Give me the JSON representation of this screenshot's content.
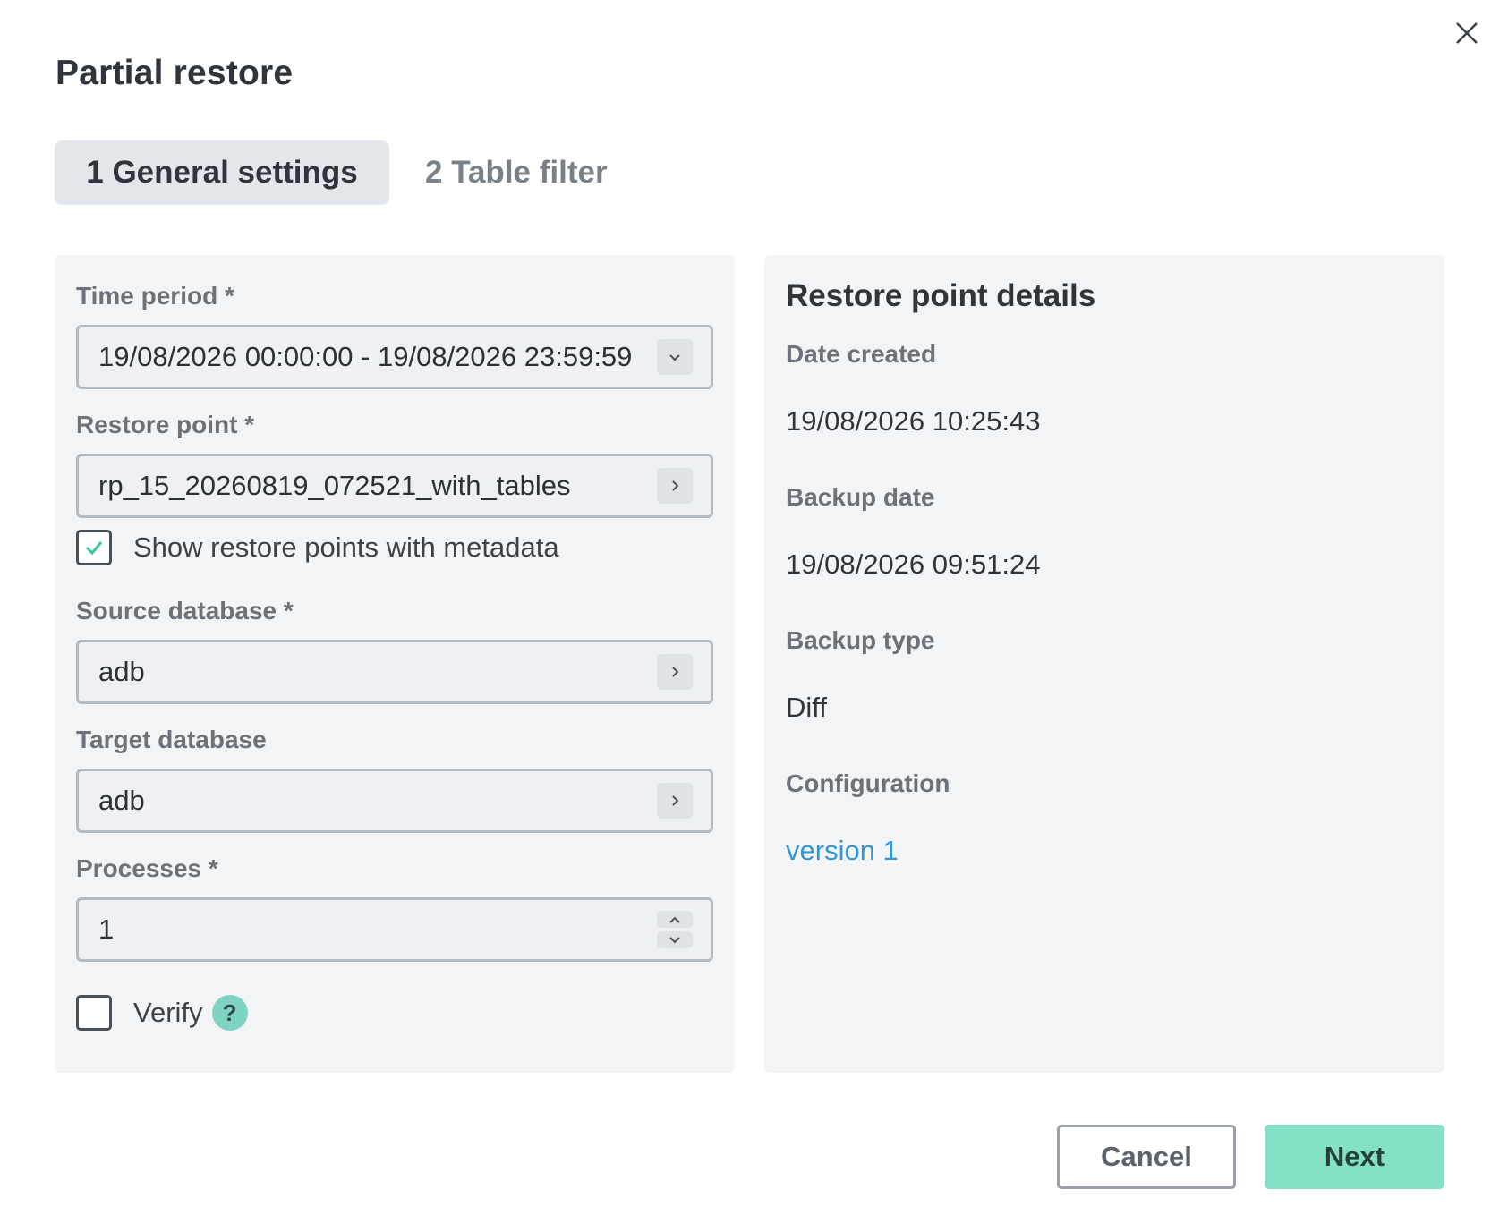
{
  "dialog": {
    "title": "Partial restore"
  },
  "tabs": [
    {
      "label": "1 General settings",
      "active": true
    },
    {
      "label": "2 Table filter",
      "active": false
    }
  ],
  "form": {
    "time_period": {
      "label": "Time period *",
      "value": "19/08/2026 00:00:00 - 19/08/2026 23:59:59"
    },
    "restore_point": {
      "label": "Restore point *",
      "value": "rp_15_20260819_072521_with_tables"
    },
    "show_metadata": {
      "label": "Show restore points with metadata",
      "checked": true
    },
    "source_database": {
      "label": "Source database *",
      "value": "adb"
    },
    "target_database": {
      "label": "Target database",
      "value": "adb"
    },
    "processes": {
      "label": "Processes *",
      "value": "1"
    },
    "verify": {
      "label": "Verify",
      "checked": false,
      "help_icon": "?"
    }
  },
  "details": {
    "title": "Restore point details",
    "date_created_label": "Date created",
    "date_created": "19/08/2026 10:25:43",
    "backup_date_label": "Backup date",
    "backup_date": "19/08/2026 09:51:24",
    "backup_type_label": "Backup type",
    "backup_type": "Diff",
    "configuration_label": "Configuration",
    "configuration": "version 1"
  },
  "footer": {
    "cancel_label": "Cancel",
    "next_label": "Next"
  },
  "colors": {
    "accent": "#84e0c6",
    "checkmark": "#3cc49a",
    "link": "#2f96d8",
    "panel_bg": "#f3f4f6"
  }
}
